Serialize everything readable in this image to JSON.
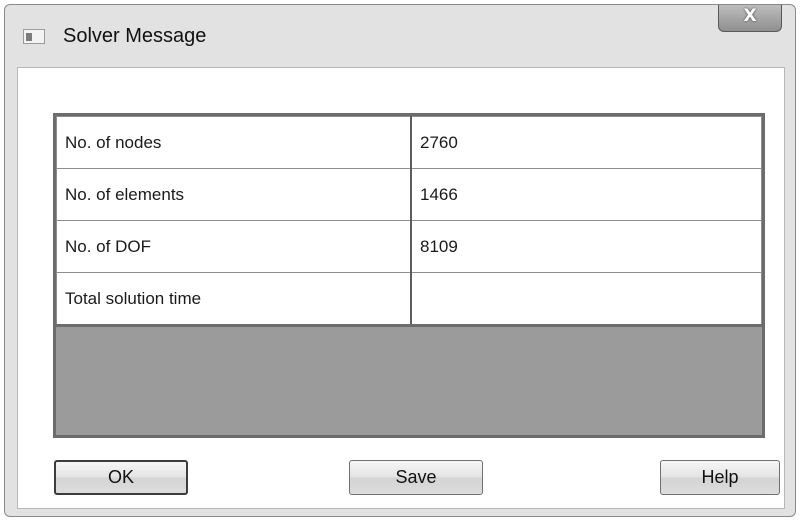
{
  "window": {
    "title": "Solver Message",
    "close_label": "X"
  },
  "table": {
    "rows": [
      {
        "label": "No. of nodes",
        "value": "2760"
      },
      {
        "label": "No. of elements",
        "value": "1466"
      },
      {
        "label": "No. of DOF",
        "value": "8109"
      },
      {
        "label": "Total solution time",
        "value": ""
      }
    ]
  },
  "buttons": {
    "ok": "OK",
    "save": "Save",
    "help": "Help"
  }
}
